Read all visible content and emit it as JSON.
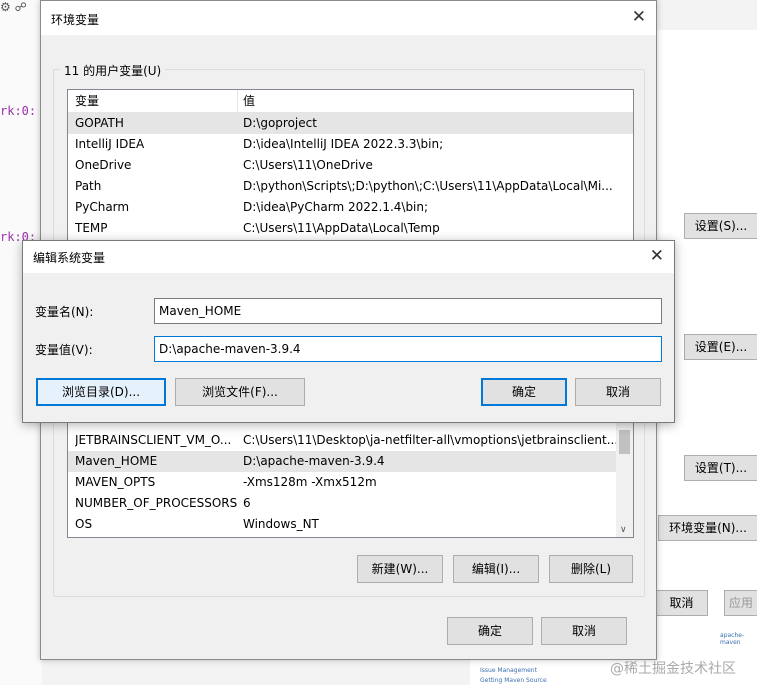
{
  "background": {
    "code_lines": [
      "rk:0:",
      "rk:0:"
    ],
    "right_buttons": [
      "设置(S)...",
      "设置(E)...",
      "设置(T)...",
      "环境变量(N)..."
    ],
    "bottom_buttons": [
      "取消",
      "应用"
    ],
    "watermark": "@稀土掘金技术社区",
    "tiny_links": [
      "Issue Management",
      "Getting Maven Source",
      "apache-maven"
    ]
  },
  "env_dialog": {
    "title": "环境变量",
    "user_group_label": "11 的用户变量(U)",
    "columns": [
      "变量",
      "值"
    ],
    "user_vars": [
      {
        "name": "GOPATH",
        "value": "D:\\goproject",
        "selected": true
      },
      {
        "name": "IntelliJ IDEA",
        "value": "D:\\idea\\IntelliJ IDEA 2022.3.3\\bin;"
      },
      {
        "name": "OneDrive",
        "value": "C:\\Users\\11\\OneDrive"
      },
      {
        "name": "Path",
        "value": "D:\\python\\Scripts\\;D:\\python\\;C:\\Users\\11\\AppData\\Local\\Mi..."
      },
      {
        "name": "PyCharm",
        "value": "D:\\idea\\PyCharm 2022.1.4\\bin;"
      },
      {
        "name": "TEMP",
        "value": "C:\\Users\\11\\AppData\\Local\\Temp"
      }
    ],
    "system_vars": [
      {
        "name": "JETBRAINSCLIENT_VM_O...",
        "value": "C:\\Users\\11\\Desktop\\ja-netfilter-all\\vmoptions\\jetbrainsclient..."
      },
      {
        "name": "Maven_HOME",
        "value": "D:\\apache-maven-3.9.4",
        "selected": true
      },
      {
        "name": "MAVEN_OPTS",
        "value": "-Xms128m -Xmx512m"
      },
      {
        "name": "NUMBER_OF_PROCESSORS",
        "value": "6"
      },
      {
        "name": "OS",
        "value": "Windows_NT"
      }
    ],
    "new_button": "新建(W)...",
    "edit_button": "编辑(I)...",
    "delete_button": "删除(L)",
    "ok_button": "确定",
    "cancel_button": "取消"
  },
  "edit_dialog": {
    "title": "编辑系统变量",
    "name_label": "变量名(N):",
    "name_value": "Maven_HOME",
    "value_label": "变量值(V):",
    "value_value": "D:\\apache-maven-3.9.4",
    "browse_dir_button": "浏览目录(D)...",
    "browse_file_button": "浏览文件(F)...",
    "ok_button": "确定",
    "cancel_button": "取消"
  }
}
